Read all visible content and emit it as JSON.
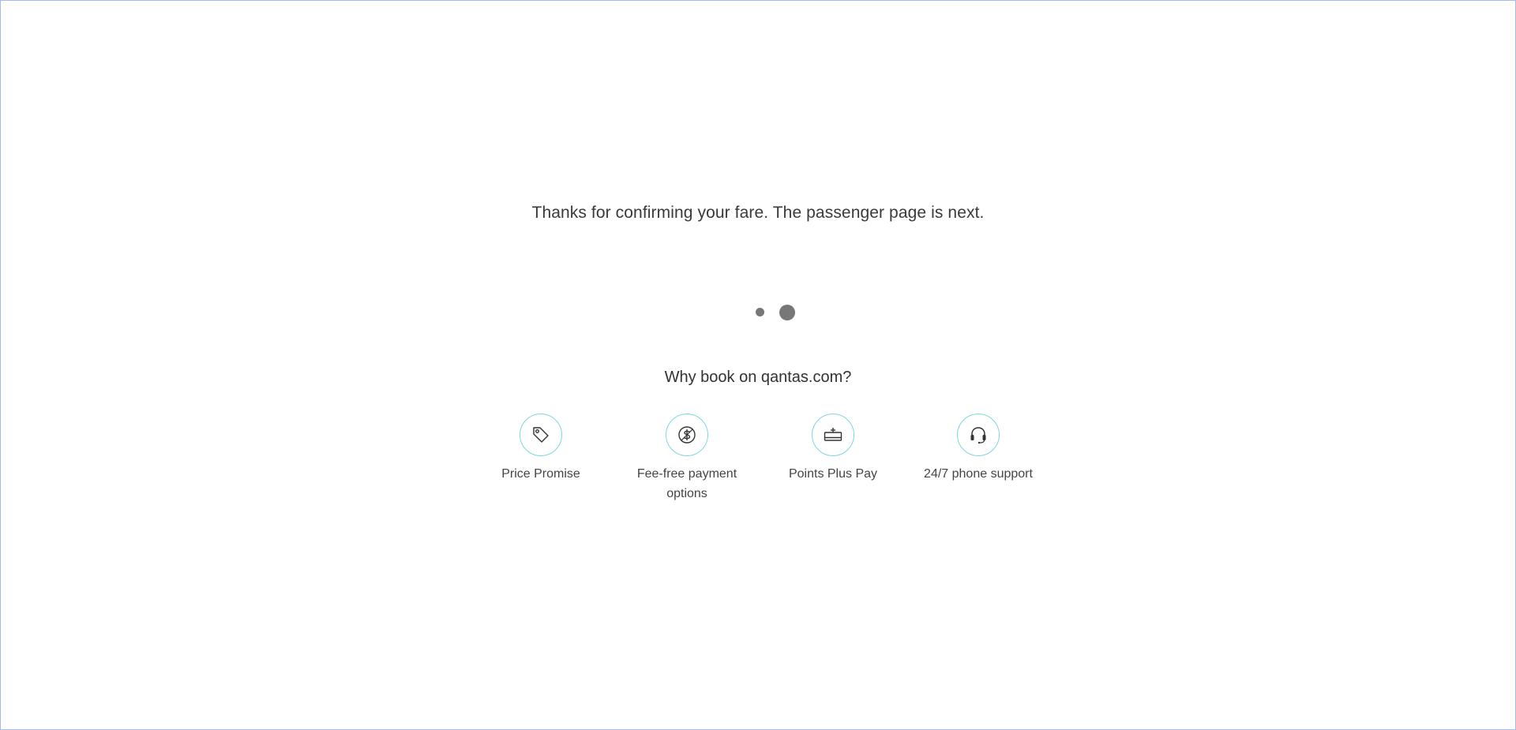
{
  "status": {
    "message": "Thanks for confirming your fare. The passenger page is next."
  },
  "loader": {
    "dot_color": "#777777"
  },
  "why_book": {
    "title": "Why book on qantas.com?",
    "items": [
      {
        "label": "Price Promise",
        "icon": "price-tag-icon"
      },
      {
        "label": "Fee-free payment options",
        "icon": "dollar-coin-icon"
      },
      {
        "label": "Points Plus Pay",
        "icon": "card-plus-icon"
      },
      {
        "label": "24/7 phone support",
        "icon": "headset-icon"
      }
    ]
  },
  "colors": {
    "icon_ring": "#7fd6e0",
    "text": "#323232",
    "frame_border": "#a9b9f0"
  }
}
